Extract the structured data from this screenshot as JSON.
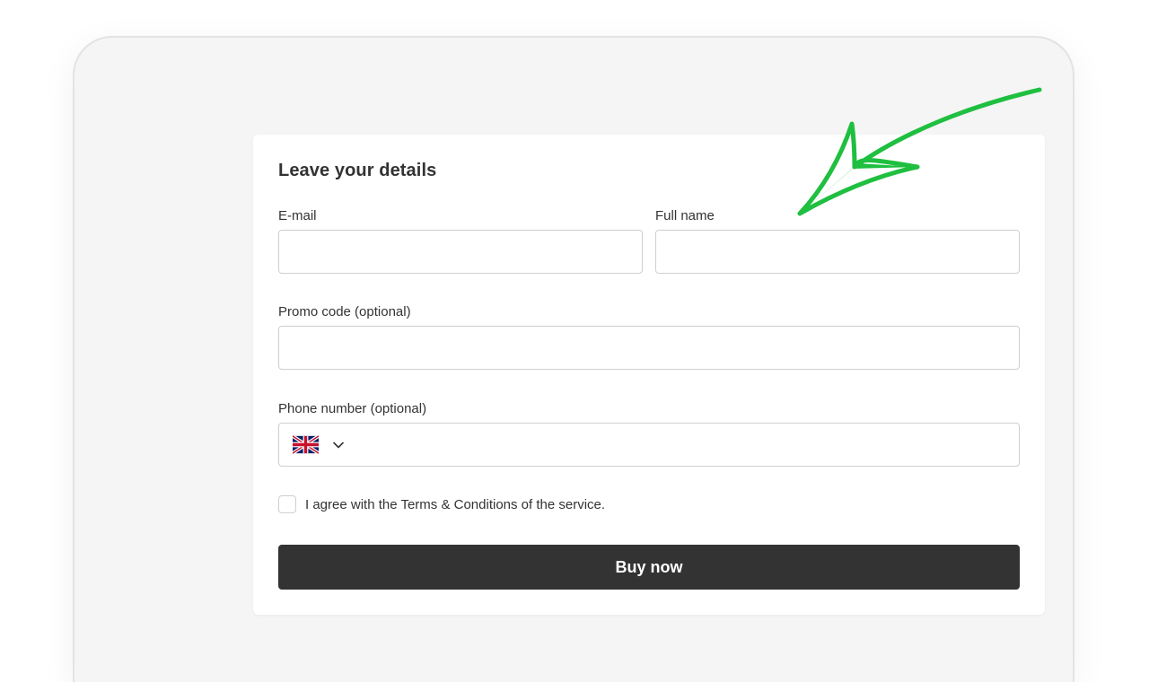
{
  "form": {
    "title": "Leave your details",
    "email": {
      "label": "E-mail",
      "value": "",
      "placeholder": ""
    },
    "full_name": {
      "label": "Full name",
      "value": "",
      "placeholder": ""
    },
    "promo_code": {
      "label": "Promo code (optional)",
      "value": "",
      "placeholder": ""
    },
    "phone": {
      "label": "Phone number (optional)",
      "country_flag": "uk-flag-icon",
      "value": "",
      "placeholder": ""
    },
    "terms": {
      "label": "I agree with the Terms & Conditions of the service.",
      "checked": false
    },
    "submit_label": "Buy now"
  },
  "annotation": {
    "icon": "green-arrow-icon",
    "color": "#1fbf40"
  },
  "colors": {
    "primary_button": "#333333",
    "text": "#333333",
    "field_border": "#cfcfcf",
    "background": "#f5f5f5"
  }
}
